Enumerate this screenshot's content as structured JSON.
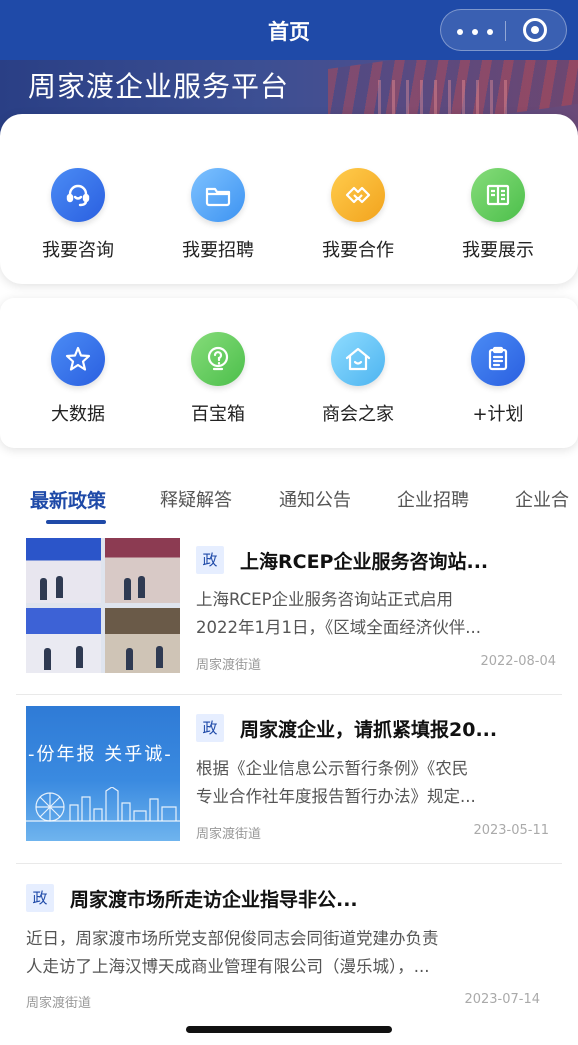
{
  "nav": {
    "title": "首页"
  },
  "banner": {
    "title": "周家渡企业服务平台"
  },
  "services": [
    {
      "label": "我要咨询",
      "icon": "headset-icon",
      "color": "#3a74ec"
    },
    {
      "label": "我要招聘",
      "icon": "folder-icon",
      "color": "#5aa8f7"
    },
    {
      "label": "我要合作",
      "icon": "handshake-icon",
      "color": "#f5b52a"
    },
    {
      "label": "我要展示",
      "icon": "book-icon",
      "color": "#62cc5e"
    }
  ],
  "tools": [
    {
      "label": "大数据",
      "icon": "star-icon",
      "color": "#3a74ec"
    },
    {
      "label": "百宝箱",
      "icon": "lightbulb-icon",
      "color": "#62cc5e"
    },
    {
      "label": "商会之家",
      "icon": "house-icon",
      "color": "#6fc6f7"
    },
    {
      "label": "+计划",
      "icon": "clipboard-icon",
      "color": "#3a74ec"
    }
  ],
  "tabs": [
    "最新政策",
    "释疑解答",
    "通知公告",
    "企业招聘",
    "企业合"
  ],
  "articles": [
    {
      "badge": "政",
      "title": "上海RCEP企业服务咨询站...",
      "desc": [
        "上海RCEP企业服务咨询站正式启用",
        "2022年1月1日，《区域全面经济伙伴..."
      ],
      "source": "周家渡街道",
      "date": "2022-08-04"
    },
    {
      "badge": "政",
      "title": "周家渡企业，请抓紧填报20...",
      "desc": [
        "根据《企业信息公示暂行条例》《农民",
        "专业合作社年度报告暂行办法》规定..."
      ],
      "source": "周家渡街道",
      "date": "2023-05-11",
      "thumb_caption": "-份年报 关乎诚-"
    },
    {
      "badge": "政",
      "title": "周家渡市场所走访企业指导非公...",
      "desc": [
        "近日，周家渡市场所党支部倪俊同志会同街道党建办负责",
        "人走访了上海汉博天成商业管理有限公司（漫乐城），..."
      ],
      "source": "周家渡街道",
      "date": "2023-07-14"
    }
  ],
  "colors": {
    "primary": "#1f4aa8",
    "badge_bg": "#e6eeff"
  }
}
